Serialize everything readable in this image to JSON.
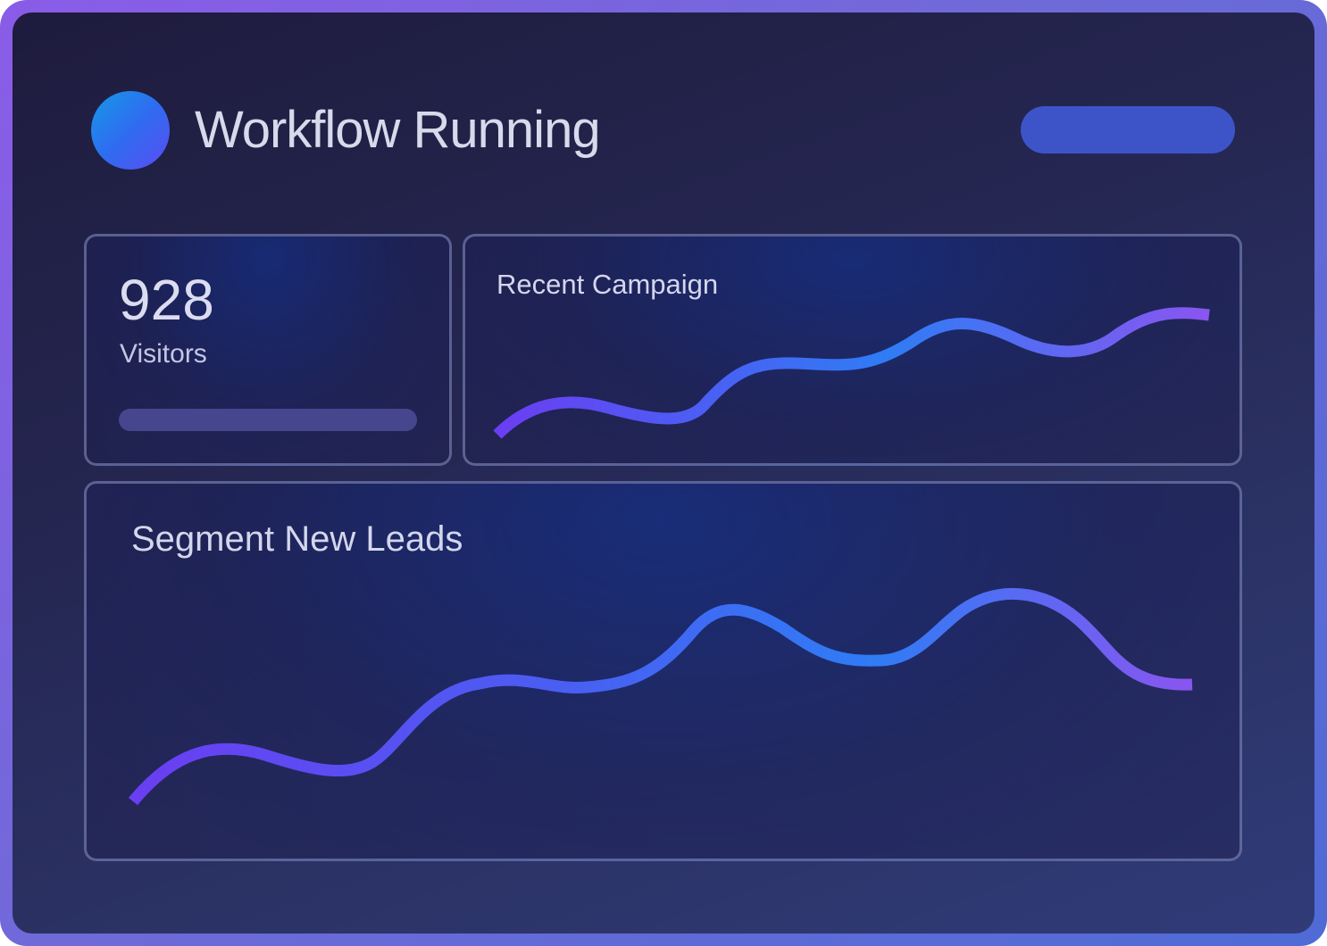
{
  "header": {
    "title": "Workflow Running",
    "status_color": "#2f6cf0",
    "action_color": "#3d54c9"
  },
  "stats": {
    "value": "928",
    "label": "Visitors"
  },
  "campaign": {
    "title": "Recent Campaign"
  },
  "segment": {
    "title": "Segment New Leads"
  },
  "colors": {
    "line_start": "#6a3ef2",
    "line_mid": "#2f7cf5",
    "line_end": "#8a55f0"
  }
}
